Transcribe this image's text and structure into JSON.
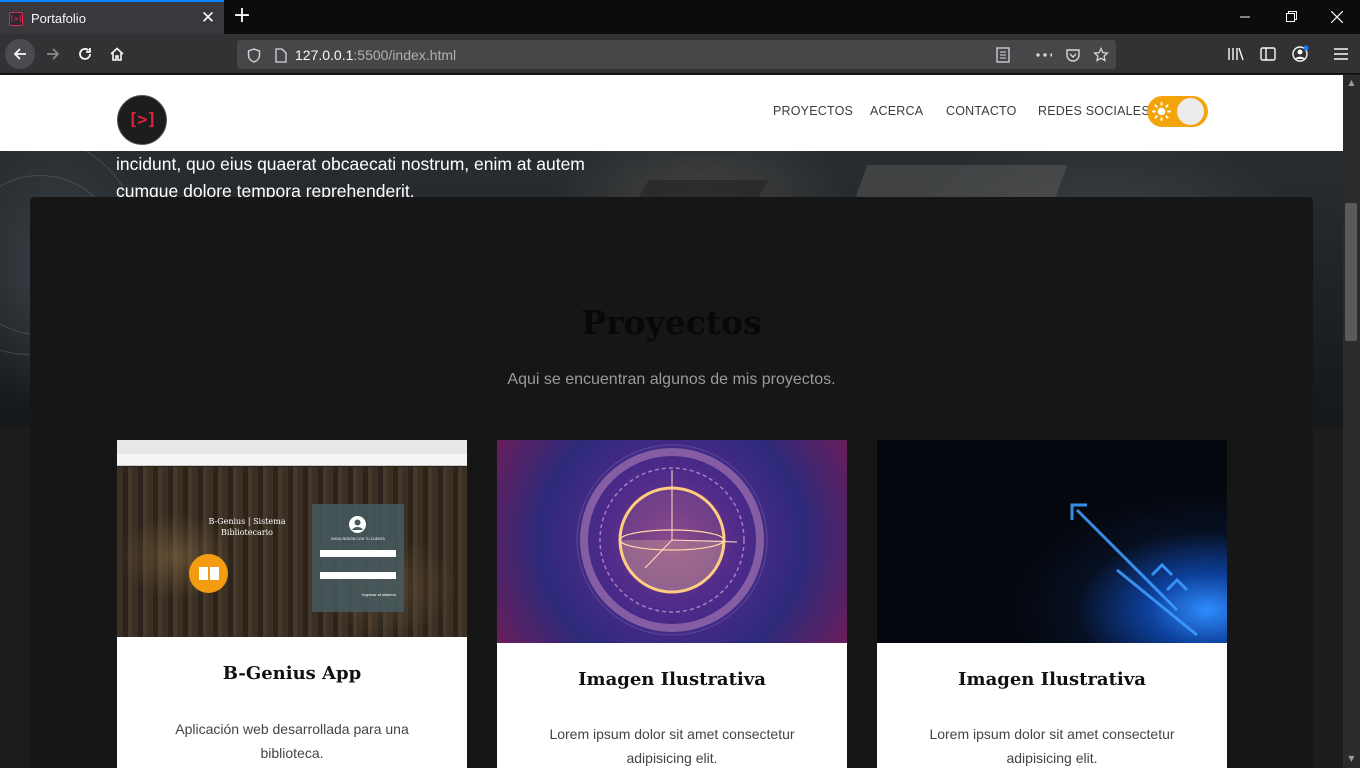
{
  "browser": {
    "tab_title": "Portafolio",
    "favicon_text": "[>]",
    "url_host": "127.0.0.1",
    "url_rest": ":5500/index.html"
  },
  "site": {
    "logo_text": "[>]",
    "menu": [
      "PROYECTOS",
      "ACERCA",
      "CONTACTO",
      "REDES SOCIALES"
    ],
    "hero_text": "incidunt, quo eius quaerat obcaecati nostrum, enim at autem cumque dolore tempora reprehenderit.",
    "theme_toggle_color": "#f4a40b"
  },
  "projects": {
    "title": "Proyectos",
    "subtitle": "Aqui se encuentran algunos de mis proyectos.",
    "cards": [
      {
        "title": "B-Genius App",
        "desc": "Aplicación web desarrollada para una biblioteca.",
        "screenshot_brand": "B-Genius | Sistema Bibliotecario",
        "screenshot_login_title": "INICIA SESIÓN CON TU CUENTA",
        "screenshot_button": "Ingresar al sistema"
      },
      {
        "title": "Imagen Ilustrativa",
        "desc": "Lorem ipsum dolor sit amet consectetur adipisicing elit."
      },
      {
        "title": "Imagen Ilustrativa",
        "desc": "Lorem ipsum dolor sit amet consectetur adipisicing elit."
      }
    ]
  }
}
